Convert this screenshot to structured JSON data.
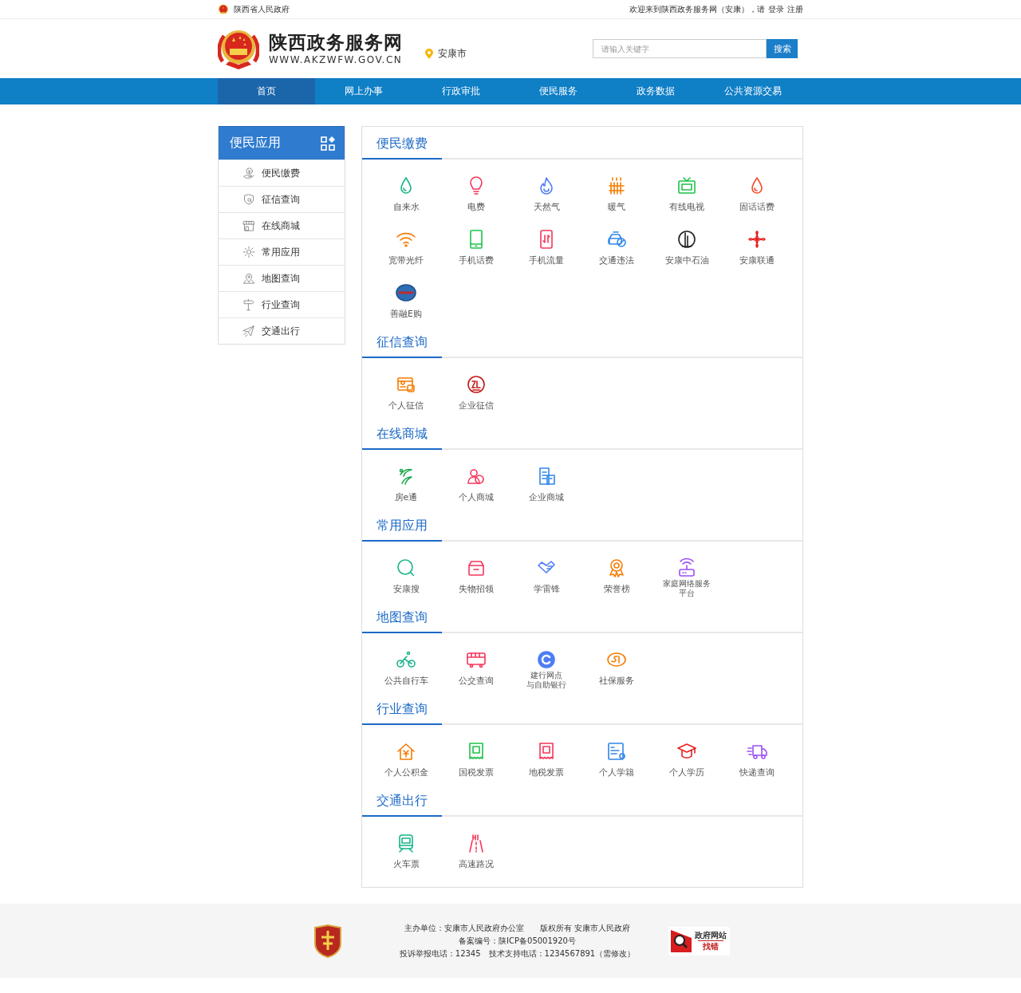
{
  "top_bar": {
    "org": "陕西省人民政府",
    "welcome": "欢迎来到陕西政务服务网（安康），请",
    "links": [
      "登录",
      "注册"
    ]
  },
  "header": {
    "title": "陕西政务服务网",
    "domain": "WWW.AKZWFW.GOV.CN",
    "location": "安康市",
    "search": {
      "placeholder": "请输入关键字",
      "button": "搜索"
    }
  },
  "nav": [
    {
      "label": "首页",
      "selected": true
    },
    {
      "label": "网上办事",
      "selected": false
    },
    {
      "label": "行政审批",
      "selected": false
    },
    {
      "label": "便民服务",
      "selected": false
    },
    {
      "label": "政务数据",
      "selected": false
    },
    {
      "label": "公共资源交易",
      "selected": false
    }
  ],
  "sidebar": {
    "title": "便民应用",
    "items": [
      "便民缴费",
      "征信查询",
      "在线商城",
      "常用应用",
      "地图查询",
      "行业查询",
      "交通出行"
    ]
  },
  "sections": [
    {
      "title": "便民缴费",
      "items": [
        "自来水",
        "电费",
        "天然气",
        "暖气",
        "有线电视",
        "固话话费",
        "宽带光纤",
        "手机话费",
        "手机流量",
        "交通违法",
        "安康中石油",
        "安康联通",
        "善融E购"
      ]
    },
    {
      "title": "征信查询",
      "items": [
        "个人征信",
        "企业征信"
      ]
    },
    {
      "title": "在线商城",
      "items": [
        "房e通",
        "个人商城",
        "企业商城"
      ]
    },
    {
      "title": "常用应用",
      "items": [
        "安康搜",
        "失物招领",
        "学雷锋",
        "荣誉榜",
        [
          "家庭网络服务",
          "平台"
        ]
      ]
    },
    {
      "title": "地图查询",
      "items": [
        "公共自行车",
        "公交查询",
        [
          "建行网点",
          "与自助银行"
        ],
        "社保服务"
      ]
    },
    {
      "title": "行业查询",
      "items": [
        "个人公积金",
        "国税发票",
        "地税发票",
        "个人学籍",
        "个人学历",
        "快递查询"
      ]
    },
    {
      "title": "交通出行",
      "items": [
        "火车票",
        "高速路况"
      ]
    }
  ],
  "footer": {
    "lines": [
      "主办单位：安康市人民政府办公室　　版权所有 安康市人民政府",
      "备案编号：陕ICP备05001920号",
      "投诉举报电话：12345　技术支持电话：1234567891（需修改）"
    ],
    "badge": [
      "政府网站",
      "找错"
    ]
  }
}
